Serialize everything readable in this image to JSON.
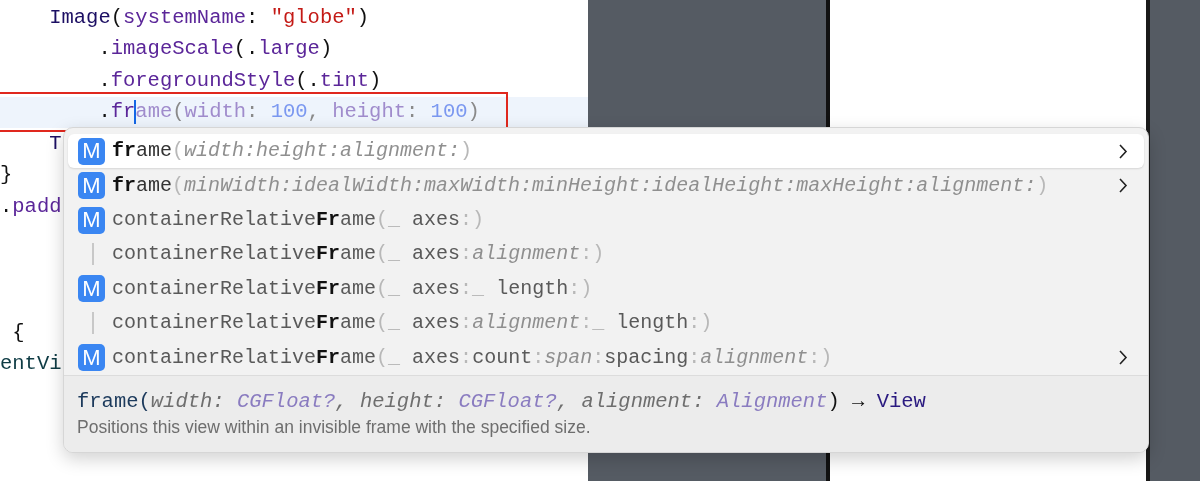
{
  "editor": {
    "lines": [
      {
        "selected": false,
        "boxed": false,
        "segments": [
          {
            "text": "    Image",
            "kind": "type"
          },
          {
            "text": "(",
            "kind": "plain"
          },
          {
            "text": "systemName",
            "kind": "fn"
          },
          {
            "text": ": ",
            "kind": "plain"
          },
          {
            "text": "\"globe\"",
            "kind": "string"
          },
          {
            "text": ")",
            "kind": "plain"
          }
        ]
      },
      {
        "selected": false,
        "boxed": false,
        "segments": [
          {
            "text": "        .",
            "kind": "plain"
          },
          {
            "text": "imageScale",
            "kind": "fn"
          },
          {
            "text": "(.",
            "kind": "plain"
          },
          {
            "text": "large",
            "kind": "fn"
          },
          {
            "text": ")",
            "kind": "plain"
          }
        ]
      },
      {
        "selected": false,
        "boxed": false,
        "segments": [
          {
            "text": "        .",
            "kind": "plain"
          },
          {
            "text": "foregroundStyle",
            "kind": "fn"
          },
          {
            "text": "(.",
            "kind": "plain"
          },
          {
            "text": "tint",
            "kind": "fn"
          },
          {
            "text": ")",
            "kind": "plain"
          }
        ]
      },
      {
        "selected": true,
        "boxed": true,
        "segments": [
          {
            "text": "        .",
            "kind": "plain"
          },
          {
            "text": "fr",
            "kind": "fn",
            "caret_after": true
          },
          {
            "text": "ame",
            "kind": "ghost-fn"
          },
          {
            "text": "(",
            "kind": "ghost"
          },
          {
            "text": "width",
            "kind": "ghost-fn"
          },
          {
            "text": ": ",
            "kind": "ghost"
          },
          {
            "text": "100",
            "kind": "ghost-number"
          },
          {
            "text": ", ",
            "kind": "ghost"
          },
          {
            "text": "height",
            "kind": "ghost-fn"
          },
          {
            "text": ": ",
            "kind": "ghost"
          },
          {
            "text": "100",
            "kind": "ghost-number"
          },
          {
            "text": ")",
            "kind": "ghost"
          }
        ]
      },
      {
        "selected": false,
        "boxed": false,
        "segments": [
          {
            "text": "    T",
            "kind": "type"
          }
        ]
      },
      {
        "selected": false,
        "boxed": false,
        "segments": [
          {
            "text": "}",
            "kind": "plain"
          }
        ]
      },
      {
        "selected": false,
        "boxed": false,
        "segments": [
          {
            "text": ".",
            "kind": "plain"
          },
          {
            "text": "padd",
            "kind": "fn"
          }
        ]
      }
    ],
    "lines_after_popup": [
      {
        "selected": false,
        "boxed": false,
        "segments": [
          {
            "text": " {",
            "kind": "plain"
          }
        ]
      },
      {
        "selected": false,
        "boxed": false,
        "segments": [
          {
            "text": "entVi",
            "kind": "ident"
          }
        ]
      }
    ]
  },
  "completions": {
    "items": [
      {
        "selected": true,
        "kind": "method",
        "badge": "M",
        "has_more": true,
        "segments": [
          {
            "text": "fr",
            "kind": "match"
          },
          {
            "text": "ame",
            "kind": "base"
          },
          {
            "text": "(",
            "kind": "muted"
          },
          {
            "text": "width:height:alignment:",
            "kind": "param"
          },
          {
            "text": ")",
            "kind": "muted"
          }
        ]
      },
      {
        "selected": false,
        "kind": "method",
        "badge": "M",
        "has_more": true,
        "segments": [
          {
            "text": "fr",
            "kind": "match"
          },
          {
            "text": "ame",
            "kind": "base"
          },
          {
            "text": "(",
            "kind": "muted"
          },
          {
            "text": "minWidth:idealWidth:maxWidth:minHeight:idealHeight:maxHeight:alignment:",
            "kind": "param"
          },
          {
            "text": ")",
            "kind": "muted"
          }
        ]
      },
      {
        "selected": false,
        "kind": "method",
        "badge": "M",
        "has_more": false,
        "segments": [
          {
            "text": "containerRelative",
            "kind": "name"
          },
          {
            "text": "Fr",
            "kind": "match"
          },
          {
            "text": "ame",
            "kind": "name"
          },
          {
            "text": "(_ ",
            "kind": "muted"
          },
          {
            "text": "axes",
            "kind": "name"
          },
          {
            "text": ":)",
            "kind": "muted"
          }
        ]
      },
      {
        "selected": false,
        "kind": "overload",
        "has_more": false,
        "segments": [
          {
            "text": "containerRelative",
            "kind": "name"
          },
          {
            "text": "Fr",
            "kind": "match"
          },
          {
            "text": "ame",
            "kind": "name"
          },
          {
            "text": "(_ ",
            "kind": "muted"
          },
          {
            "text": "axes",
            "kind": "name"
          },
          {
            "text": ":",
            "kind": "muted"
          },
          {
            "text": "alignment",
            "kind": "param"
          },
          {
            "text": ":)",
            "kind": "muted"
          }
        ]
      },
      {
        "selected": false,
        "kind": "method",
        "badge": "M",
        "has_more": false,
        "segments": [
          {
            "text": "containerRelative",
            "kind": "name"
          },
          {
            "text": "Fr",
            "kind": "match"
          },
          {
            "text": "ame",
            "kind": "name"
          },
          {
            "text": "(_ ",
            "kind": "muted"
          },
          {
            "text": "axes",
            "kind": "name"
          },
          {
            "text": ":_ ",
            "kind": "muted"
          },
          {
            "text": "length",
            "kind": "name"
          },
          {
            "text": ":)",
            "kind": "muted"
          }
        ]
      },
      {
        "selected": false,
        "kind": "overload",
        "has_more": false,
        "segments": [
          {
            "text": "containerRelative",
            "kind": "name"
          },
          {
            "text": "Fr",
            "kind": "match"
          },
          {
            "text": "ame",
            "kind": "name"
          },
          {
            "text": "(_ ",
            "kind": "muted"
          },
          {
            "text": "axes",
            "kind": "name"
          },
          {
            "text": ":",
            "kind": "muted"
          },
          {
            "text": "alignment",
            "kind": "param"
          },
          {
            "text": ":_ ",
            "kind": "muted"
          },
          {
            "text": "length",
            "kind": "name"
          },
          {
            "text": ":)",
            "kind": "muted"
          }
        ]
      },
      {
        "selected": false,
        "kind": "method",
        "badge": "M",
        "has_more": true,
        "segments": [
          {
            "text": "containerRelative",
            "kind": "name"
          },
          {
            "text": "Fr",
            "kind": "match"
          },
          {
            "text": "ame",
            "kind": "name"
          },
          {
            "text": "(_ ",
            "kind": "muted"
          },
          {
            "text": "axes",
            "kind": "name"
          },
          {
            "text": ":",
            "kind": "muted"
          },
          {
            "text": "count",
            "kind": "name"
          },
          {
            "text": ":",
            "kind": "muted"
          },
          {
            "text": "span",
            "kind": "param"
          },
          {
            "text": ":",
            "kind": "muted"
          },
          {
            "text": "spacing",
            "kind": "name"
          },
          {
            "text": ":",
            "kind": "muted"
          },
          {
            "text": "alignment",
            "kind": "param"
          },
          {
            "text": ":)",
            "kind": "muted"
          }
        ]
      }
    ],
    "signature": [
      {
        "text": "frame(",
        "kind": "sig-name"
      },
      {
        "text": "width: ",
        "kind": "sig-label"
      },
      {
        "text": "CGFloat?",
        "kind": "sig-type"
      },
      {
        "text": ", ",
        "kind": "sig-label"
      },
      {
        "text": "height: ",
        "kind": "sig-label"
      },
      {
        "text": "CGFloat?",
        "kind": "sig-type"
      },
      {
        "text": ", ",
        "kind": "sig-label"
      },
      {
        "text": "alignment: ",
        "kind": "sig-label"
      },
      {
        "text": "Alignment",
        "kind": "sig-type"
      },
      {
        "text": ") → ",
        "kind": "sig-plain"
      },
      {
        "text": "View",
        "kind": "sig-return"
      }
    ],
    "description": "Positions this view within an invisible frame with the specified size."
  }
}
